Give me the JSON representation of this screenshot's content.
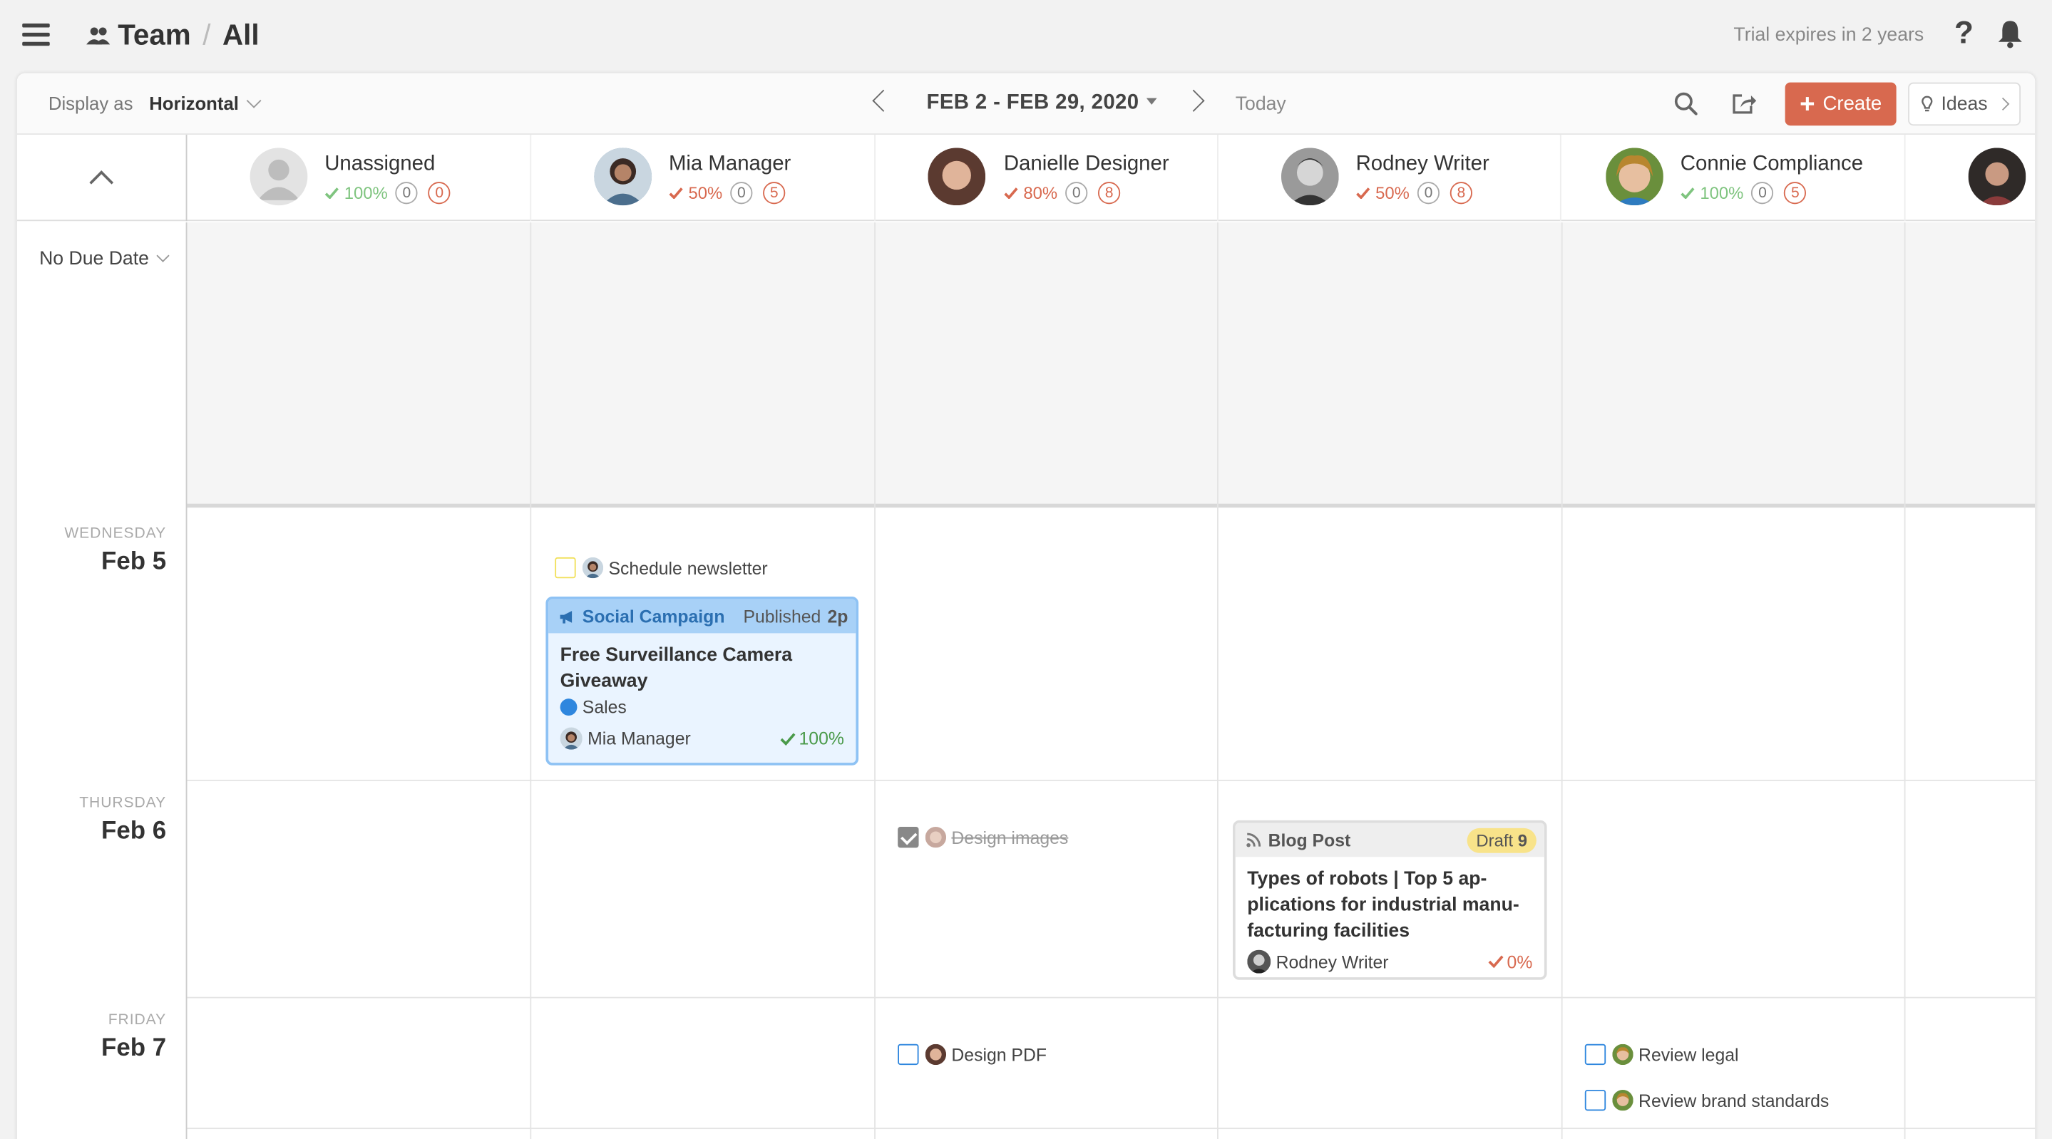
{
  "header": {
    "breadcrumb": [
      "Team",
      "All"
    ],
    "trial": "Trial expires in 2 years"
  },
  "toolbar": {
    "display_as_label": "Display as",
    "display_as_value": "Horizontal",
    "date_range": "FEB 2 - FEB 29, 2020",
    "today": "Today",
    "create": "Create",
    "ideas": "Ideas"
  },
  "people": [
    {
      "name": "Unassigned",
      "pct": "100%",
      "pct_color": "#7fc47f",
      "open": "0",
      "late": "0"
    },
    {
      "name": "Mia Manager",
      "pct": "50%",
      "pct_color": "#d8694f",
      "open": "0",
      "late": "5"
    },
    {
      "name": "Danielle Designer",
      "pct": "80%",
      "pct_color": "#d8694f",
      "open": "0",
      "late": "8"
    },
    {
      "name": "Rodney Writer",
      "pct": "50%",
      "pct_color": "#d8694f",
      "open": "0",
      "late": "8"
    },
    {
      "name": "Connie Compliance",
      "pct": "100%",
      "pct_color": "#7fc47f",
      "open": "0",
      "late": "5"
    }
  ],
  "no_due_label": "No Due Date",
  "days": [
    {
      "dow": "WEDNESDAY",
      "date": "Feb 5"
    },
    {
      "dow": "THURSDAY",
      "date": "Feb 6"
    },
    {
      "dow": "FRIDAY",
      "date": "Feb 7"
    }
  ],
  "tasks": {
    "schedule_newsletter": "Schedule newsletter",
    "design_images": "Design images",
    "design_pdf": "Design PDF",
    "review_legal": "Review legal",
    "review_brand": "Review brand standards"
  },
  "social_card": {
    "type": "Social Campaign",
    "status": "Published",
    "status_count": "2p",
    "title": "Free Surveillance Camera Giveaway",
    "tag": "Sales",
    "owner": "Mia Manager",
    "pct": "100%"
  },
  "blog_card": {
    "type": "Blog Post",
    "status": "Draft",
    "status_count": "9",
    "title": "Types of robots | Top 5 ap-plications for industrial manu-facturing facilities",
    "owner": "Rodney Writer",
    "pct": "0%"
  },
  "colors": {
    "accent": "#d8694f",
    "social": "#a8d1f7",
    "tag_sales": "#2e86de"
  }
}
